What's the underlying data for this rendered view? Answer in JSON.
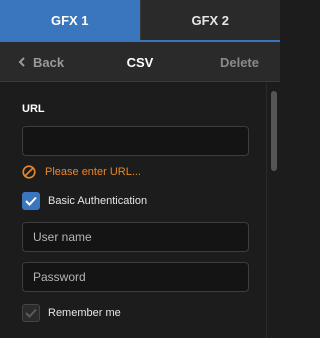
{
  "tabs": [
    {
      "label": "GFX 1",
      "active": true
    },
    {
      "label": "GFX 2",
      "active": false
    }
  ],
  "header": {
    "back_label": "Back",
    "title": "CSV",
    "delete_label": "Delete"
  },
  "form": {
    "url_label": "URL",
    "url_value": "",
    "warning_text": "Please enter URL...",
    "basic_auth_label": "Basic Authentication",
    "basic_auth_checked": true,
    "username_placeholder": "User name",
    "password_placeholder": "Password",
    "remember_label": "Remember me",
    "remember_checked": false
  },
  "colors": {
    "accent": "#3a76bd",
    "warning": "#e8872b",
    "background": "#1c1c1c"
  },
  "icons": {
    "back": "chevron-left-icon",
    "warning": "prohibited-icon",
    "check": "checkmark-icon"
  }
}
